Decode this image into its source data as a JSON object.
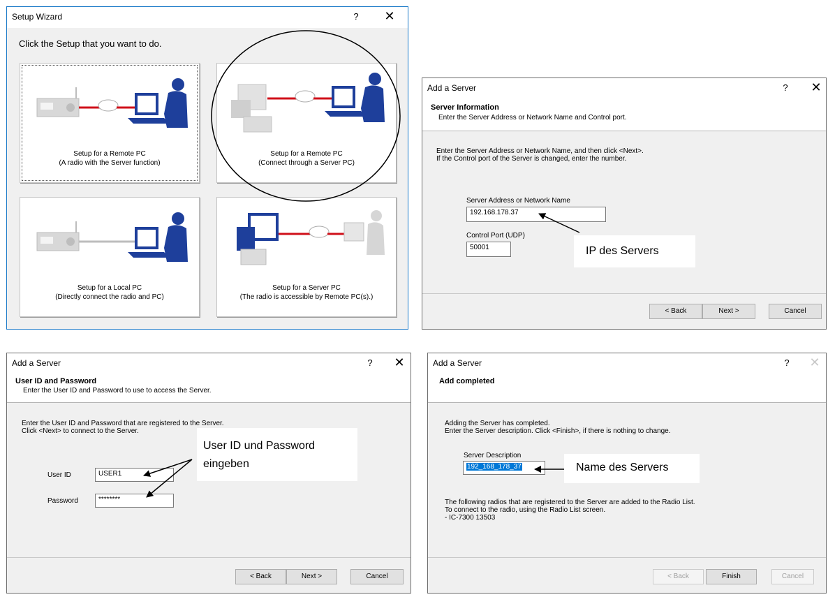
{
  "wizard": {
    "title": "Setup Wizard",
    "help": "?",
    "close": "✕",
    "prompt": "Click the Setup that you want to do.",
    "options": [
      {
        "line1": "Setup for a Remote PC",
        "line2": "(A radio with the Server function)"
      },
      {
        "line1": "Setup for a Remote PC",
        "line2": "(Connect through a Server PC)"
      },
      {
        "line1": "Setup for a Local PC",
        "line2": "(Directly connect the radio and PC)"
      },
      {
        "line1": "Setup for a Server PC",
        "line2": "(The radio is accessible by Remote PC(s).)"
      }
    ]
  },
  "server_info": {
    "title": "Add a Server",
    "help": "?",
    "close": "✕",
    "header_title": "Server Information",
    "header_sub": "Enter the Server Address or Network Name and Control port.",
    "instr1": "Enter the Server Address or Network Name, and then click <Next>.",
    "instr2": "If the Control port of the Server is changed, enter the number.",
    "address_label": "Server Address or Network Name",
    "address_value": "192.168.178.37",
    "port_label": "Control Port (UDP)",
    "port_value": "50001",
    "callout": "IP des Servers",
    "back": "< Back",
    "next": "Next >",
    "cancel": "Cancel"
  },
  "credentials": {
    "title": "Add a Server",
    "help": "?",
    "close": "✕",
    "header_title": "User ID and Password",
    "header_sub": "Enter the User ID and Password to use to access the Server.",
    "instr1": "Enter the User ID and Password that are registered to the Server.",
    "instr2": "Click <Next> to connect to the Server.",
    "userid_label": "User ID",
    "userid_value": "USER1",
    "password_label": "Password",
    "password_value": "********",
    "callout_line1": "User ID und Password",
    "callout_line2": "eingeben",
    "back": "< Back",
    "next": "Next >",
    "cancel": "Cancel"
  },
  "completed": {
    "title": "Add a Server",
    "help": "?",
    "close": "✕",
    "header_title": "Add completed",
    "instr1": "Adding the Server has completed.",
    "instr2": "Enter the Server description. Click <Finish>, if there is nothing to change.",
    "desc_label": "Server Description",
    "desc_value": "192_168_178_37",
    "callout": "Name des Servers",
    "note1": "The following radios that are registered to the Server are added to the Radio List.",
    "note2": "To connect to the radio, using the Radio List screen.",
    "note3": " - IC-7300 13503",
    "back": "< Back",
    "finish": "Finish",
    "cancel": "Cancel"
  },
  "colors": {
    "accent": "#1a79c8",
    "illustration_blue": "#1e3f9b",
    "link_red": "#d0101a",
    "selection": "#0078d7"
  }
}
